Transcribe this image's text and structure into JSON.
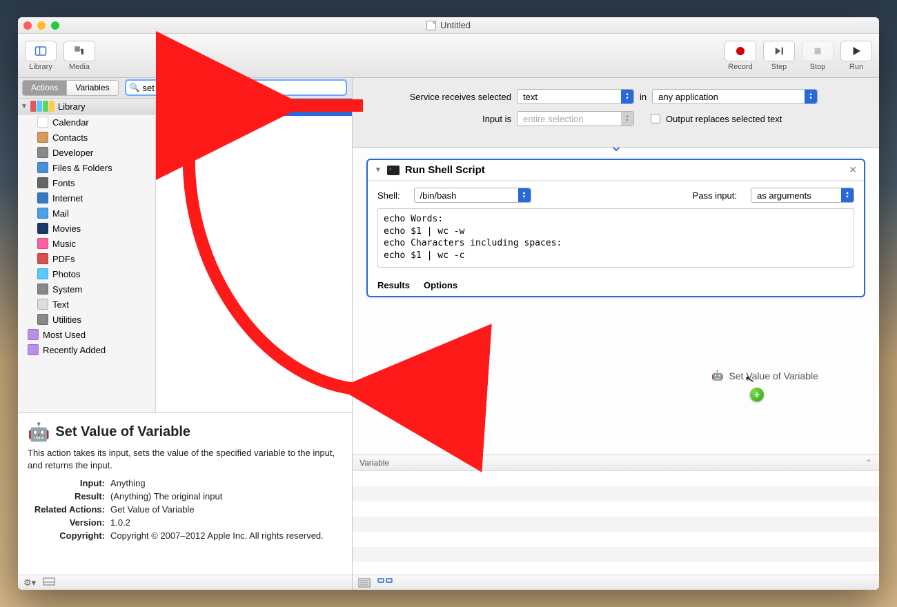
{
  "window": {
    "title": "Untitled"
  },
  "toolbar": {
    "library": "Library",
    "media": "Media",
    "record": "Record",
    "step": "Step",
    "stop": "Stop",
    "run": "Run"
  },
  "tabs": {
    "actions": "Actions",
    "variables": "Variables"
  },
  "search": {
    "value": "set value"
  },
  "library": {
    "header": "Library",
    "items": [
      "Calendar",
      "Contacts",
      "Developer",
      "Files & Folders",
      "Fonts",
      "Internet",
      "Mail",
      "Movies",
      "Music",
      "PDFs",
      "Photos",
      "System",
      "Text",
      "Utilities"
    ],
    "smart": [
      "Most Used",
      "Recently Added"
    ]
  },
  "results": {
    "item": "Set Value of Variable"
  },
  "desc": {
    "title": "Set Value of Variable",
    "body": "This action takes its input, sets the value of the specified variable to the input, and returns the input.",
    "rows": {
      "Input": "Anything",
      "Result": "(Anything) The original input",
      "Related Actions": "Get Value of Variable",
      "Version": "1.0.2",
      "Copyright": "Copyright © 2007–2012 Apple Inc.  All rights reserved."
    }
  },
  "config": {
    "row1_label": "Service receives selected",
    "row1_sel1": "text",
    "row1_mid": "in",
    "row1_sel2": "any application",
    "row2_label": "Input is",
    "row2_sel": "entire selection",
    "row2_check": "Output replaces selected text"
  },
  "action": {
    "title": "Run Shell Script",
    "shell_label": "Shell:",
    "shell_value": "/bin/bash",
    "pass_label": "Pass input:",
    "pass_value": "as arguments",
    "script": "echo Words:\necho $1 | wc -w\necho Characters including spaces:\necho $1 | wc -c",
    "results": "Results",
    "options": "Options"
  },
  "drag": {
    "label": "Set Value of Variable"
  },
  "variable_header": "Variable",
  "icon_colors": {
    "Calendar": "#fff",
    "Contacts": "#d89a5a",
    "Developer": "#888",
    "Files & Folders": "#4a90d9",
    "Fonts": "#666",
    "Internet": "#3a78c2",
    "Mail": "#4aa0e8",
    "Movies": "#1a3a6a",
    "Music": "#ff5fa2",
    "PDFs": "#d94f4f",
    "Photos": "#5ac8fa",
    "System": "#888",
    "Text": "#ddd",
    "Utilities": "#888"
  }
}
